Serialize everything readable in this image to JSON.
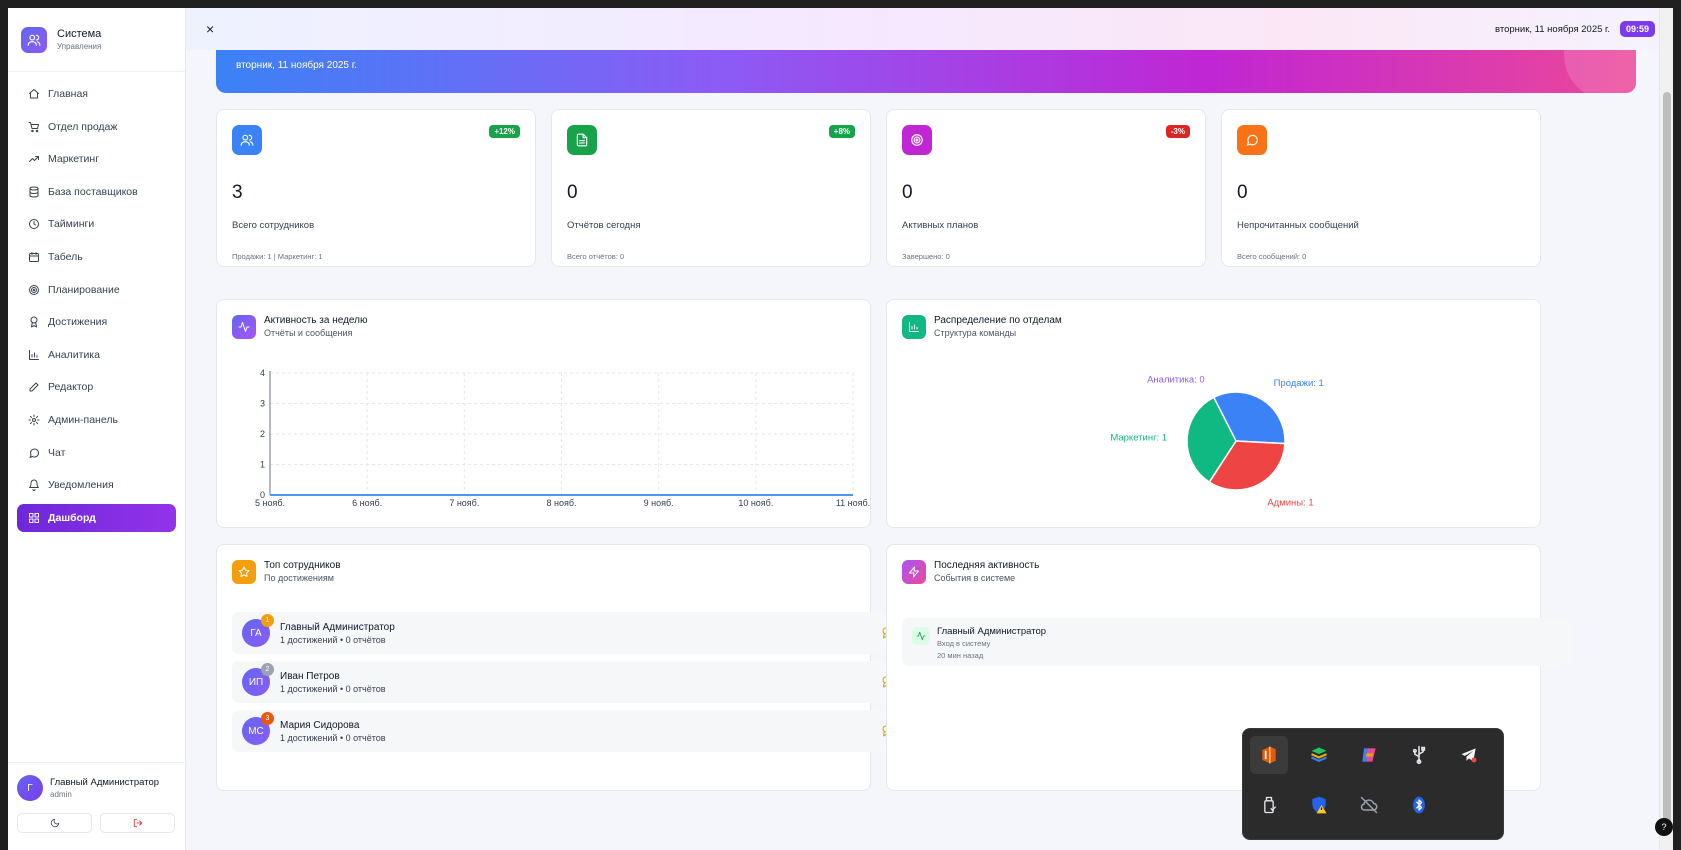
{
  "brand": {
    "title": "Система",
    "subtitle": "Управления"
  },
  "sidebar": {
    "items": [
      {
        "label": "Главная",
        "icon": "home-icon"
      },
      {
        "label": "Отдел продаж",
        "icon": "cart-icon"
      },
      {
        "label": "Маркетинг",
        "icon": "trending-up-icon"
      },
      {
        "label": "База поставщиков",
        "icon": "database-icon"
      },
      {
        "label": "Тайминги",
        "icon": "clock-icon"
      },
      {
        "label": "Табель",
        "icon": "calendar-icon"
      },
      {
        "label": "Планирование",
        "icon": "target-icon"
      },
      {
        "label": "Достижения",
        "icon": "award-icon"
      },
      {
        "label": "Аналитика",
        "icon": "bar-chart-icon"
      },
      {
        "label": "Редактор",
        "icon": "edit-icon"
      },
      {
        "label": "Админ-панель",
        "icon": "settings-icon"
      },
      {
        "label": "Чат",
        "icon": "message-icon"
      },
      {
        "label": "Уведомления",
        "icon": "bell-icon"
      },
      {
        "label": "Дашборд",
        "icon": "grid-icon",
        "active": true
      }
    ],
    "user": {
      "initial": "Г",
      "name": "Главный Администратор",
      "role": "admin"
    }
  },
  "topbar": {
    "close": "×",
    "date": "вторник, 11 ноября 2025 г.",
    "time": "09:59"
  },
  "hero": {
    "date": "вторник, 11 ноября 2025 г."
  },
  "stats": [
    {
      "value": "3",
      "label": "Всего сотрудников",
      "sub": "Продажи: 1 | Маркетинг: 1",
      "badge": "+12%",
      "badge_color": "#16a34a",
      "icon": "users-icon",
      "color": "#3b82f6"
    },
    {
      "value": "0",
      "label": "Отчётов сегодня",
      "sub": "Всего отчётов: 0",
      "badge": "+8%",
      "badge_color": "#16a34a",
      "icon": "file-icon",
      "color": "#16a34a"
    },
    {
      "value": "0",
      "label": "Активных планов",
      "sub": "Завершено: 0",
      "badge": "-3%",
      "badge_color": "#dc2626",
      "icon": "target-icon",
      "color": "#c026d3"
    },
    {
      "value": "0",
      "label": "Непрочитанных сообщений",
      "sub": "Всего сообщений: 0",
      "badge": "",
      "badge_color": "",
      "icon": "message-icon",
      "color": "#f97316"
    }
  ],
  "activity": {
    "title": "Активность за неделю",
    "subtitle": "Отчёты и сообщения"
  },
  "distribution": {
    "title": "Распределение по отделам",
    "subtitle": "Структура команды"
  },
  "top_employees": {
    "title": "Топ сотрудников",
    "subtitle": "По достижениям",
    "rows": [
      {
        "initials": "ГА",
        "rank": "1",
        "rank_color": "#f59e0b",
        "name": "Главный Администратор",
        "meta": "1 достижений • 0 отчётов"
      },
      {
        "initials": "ИП",
        "rank": "2",
        "rank_color": "#9ca3af",
        "name": "Иван Петров",
        "meta": "1 достижений • 0 отчётов"
      },
      {
        "initials": "МС",
        "rank": "3",
        "rank_color": "#ea580c",
        "name": "Мария Сидорова",
        "meta": "1 достижений • 0 отчётов"
      }
    ]
  },
  "recent_activity": {
    "title": "Последняя активность",
    "subtitle": "События в системе",
    "item": {
      "name": "Главный Администратор",
      "desc": "Вход в систему",
      "time": "20 мин назад"
    }
  },
  "tray": {
    "icons": [
      "office-icon",
      "bluestacks-icon",
      "copilot-icon",
      "usb-icon",
      "telegram-icon",
      "usb-drive-icon",
      "defender-warning-icon",
      "cloud-off-icon",
      "bluetooth-icon"
    ]
  },
  "chart_data": [
    {
      "type": "line",
      "x": [
        "5 нояб.",
        "6 нояб.",
        "7 нояб.",
        "8 нояб.",
        "9 нояб.",
        "10 нояб.",
        "11 нояб."
      ],
      "series": [
        {
          "values": [
            0,
            0,
            0,
            0,
            0,
            0,
            0
          ],
          "color": "#14b8a6"
        },
        {
          "values": [
            0,
            0,
            0,
            0,
            0,
            0,
            0
          ],
          "color": "#3b82f6"
        }
      ],
      "ylim": [
        0,
        4
      ],
      "yticks": [
        "0",
        "1",
        "2",
        "3",
        "4"
      ],
      "grid": true
    },
    {
      "type": "pie",
      "slices": [
        {
          "label": "Продажи: 1",
          "value": 1,
          "color": "#3b82f6"
        },
        {
          "label": "Админы: 1",
          "value": 1,
          "color": "#ef4444"
        },
        {
          "label": "Маркетинг: 1",
          "value": 1,
          "color": "#10b981"
        },
        {
          "label": "Аналитика: 0",
          "value": 0,
          "color": "#8b5cf6"
        }
      ]
    }
  ]
}
